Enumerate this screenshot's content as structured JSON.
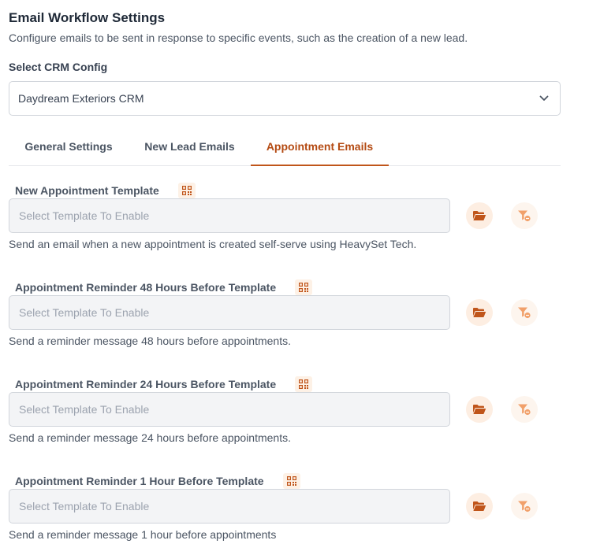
{
  "header": {
    "title": "Email Workflow Settings",
    "subtitle": "Configure emails to be sent in response to specific events, such as the creation of a new lead."
  },
  "crm": {
    "label": "Select CRM Config",
    "selected": "Daydream Exteriors CRM"
  },
  "tabs": [
    {
      "label": "General Settings",
      "active": false
    },
    {
      "label": "New Lead Emails",
      "active": false
    },
    {
      "label": "Appointment Emails",
      "active": true
    }
  ],
  "sections": [
    {
      "label": "New Appointment Template",
      "placeholder": "Select Template To Enable",
      "help": "Send an email when a new appointment is created self-serve using HeavySet Tech."
    },
    {
      "label": "Appointment Reminder 48 Hours Before Template",
      "placeholder": "Select Template To Enable",
      "help": "Send a reminder message 48 hours before appointments."
    },
    {
      "label": "Appointment Reminder 24 Hours Before Template",
      "placeholder": "Select Template To Enable",
      "help": "Send a reminder message 24 hours before appointments."
    },
    {
      "label": "Appointment Reminder 1 Hour Before Template",
      "placeholder": "Select Template To Enable",
      "help": "Send a reminder message 1 hour before appointments"
    }
  ],
  "icons": {
    "qr": "qr-code-icon",
    "folder": "folder-open-icon",
    "filter": "filter-clear-icon",
    "chevron": "chevron-down-icon"
  },
  "colors": {
    "accent": "#c0551a",
    "accent_light": "#fdeee2",
    "text": "#1f2937",
    "muted": "#4b5563",
    "input_bg": "#f3f4f6"
  }
}
